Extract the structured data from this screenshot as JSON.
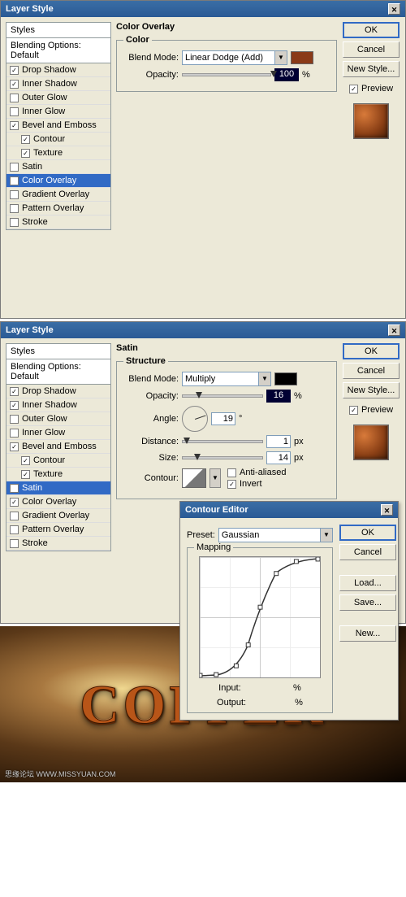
{
  "dialog1": {
    "title": "Layer Style",
    "stylesHeader": "Styles",
    "blendingOptions": "Blending Options: Default",
    "items": [
      {
        "label": "Drop Shadow",
        "checked": true,
        "indent": false
      },
      {
        "label": "Inner Shadow",
        "checked": true,
        "indent": false
      },
      {
        "label": "Outer Glow",
        "checked": false,
        "indent": false
      },
      {
        "label": "Inner Glow",
        "checked": false,
        "indent": false
      },
      {
        "label": "Bevel and Emboss",
        "checked": true,
        "indent": false
      },
      {
        "label": "Contour",
        "checked": true,
        "indent": true
      },
      {
        "label": "Texture",
        "checked": true,
        "indent": true
      },
      {
        "label": "Satin",
        "checked": false,
        "indent": false
      },
      {
        "label": "Color Overlay",
        "checked": true,
        "indent": false,
        "selected": true
      },
      {
        "label": "Gradient Overlay",
        "checked": false,
        "indent": false
      },
      {
        "label": "Pattern Overlay",
        "checked": false,
        "indent": false
      },
      {
        "label": "Stroke",
        "checked": false,
        "indent": false
      }
    ],
    "panelTitle": "Color Overlay",
    "groupTitle": "Color",
    "blendModeLabel": "Blend Mode:",
    "blendModeValue": "Linear Dodge (Add)",
    "swatchColor": "#8a3a18",
    "opacityLabel": "Opacity:",
    "opacityValue": "100",
    "percent": "%"
  },
  "dialog2": {
    "title": "Layer Style",
    "stylesHeader": "Styles",
    "blendingOptions": "Blending Options: Default",
    "items": [
      {
        "label": "Drop Shadow",
        "checked": true,
        "indent": false
      },
      {
        "label": "Inner Shadow",
        "checked": true,
        "indent": false
      },
      {
        "label": "Outer Glow",
        "checked": false,
        "indent": false
      },
      {
        "label": "Inner Glow",
        "checked": false,
        "indent": false
      },
      {
        "label": "Bevel and Emboss",
        "checked": true,
        "indent": false
      },
      {
        "label": "Contour",
        "checked": true,
        "indent": true
      },
      {
        "label": "Texture",
        "checked": true,
        "indent": true
      },
      {
        "label": "Satin",
        "checked": true,
        "indent": false,
        "selected": true
      },
      {
        "label": "Color Overlay",
        "checked": true,
        "indent": false
      },
      {
        "label": "Gradient Overlay",
        "checked": false,
        "indent": false
      },
      {
        "label": "Pattern Overlay",
        "checked": false,
        "indent": false
      },
      {
        "label": "Stroke",
        "checked": false,
        "indent": false
      }
    ],
    "panelTitle": "Satin",
    "groupTitle": "Structure",
    "blendModeLabel": "Blend Mode:",
    "blendModeValue": "Multiply",
    "swatchColor": "#000000",
    "opacityLabel": "Opacity:",
    "opacityValue": "16",
    "percent": "%",
    "angleLabel": "Angle:",
    "angleValue": "19",
    "degree": "°",
    "distanceLabel": "Distance:",
    "distanceValue": "1",
    "px": "px",
    "sizeLabel": "Size:",
    "sizeValue": "14",
    "contourLabel": "Contour:",
    "antialiased": "Anti-aliased",
    "invert": "Invert"
  },
  "buttons": {
    "ok": "OK",
    "cancel": "Cancel",
    "newStyle": "New Style...",
    "preview": "Preview",
    "load": "Load...",
    "save": "Save...",
    "new": "New..."
  },
  "contourEditor": {
    "title": "Contour Editor",
    "presetLabel": "Preset:",
    "presetValue": "Gaussian",
    "mappingLabel": "Mapping",
    "inputLabel": "Input:",
    "outputLabel": "Output:",
    "percent": "%"
  },
  "copper": {
    "text": "COPPER",
    "watermark": "思缘论坛  WWW.MISSYUAN.COM"
  }
}
